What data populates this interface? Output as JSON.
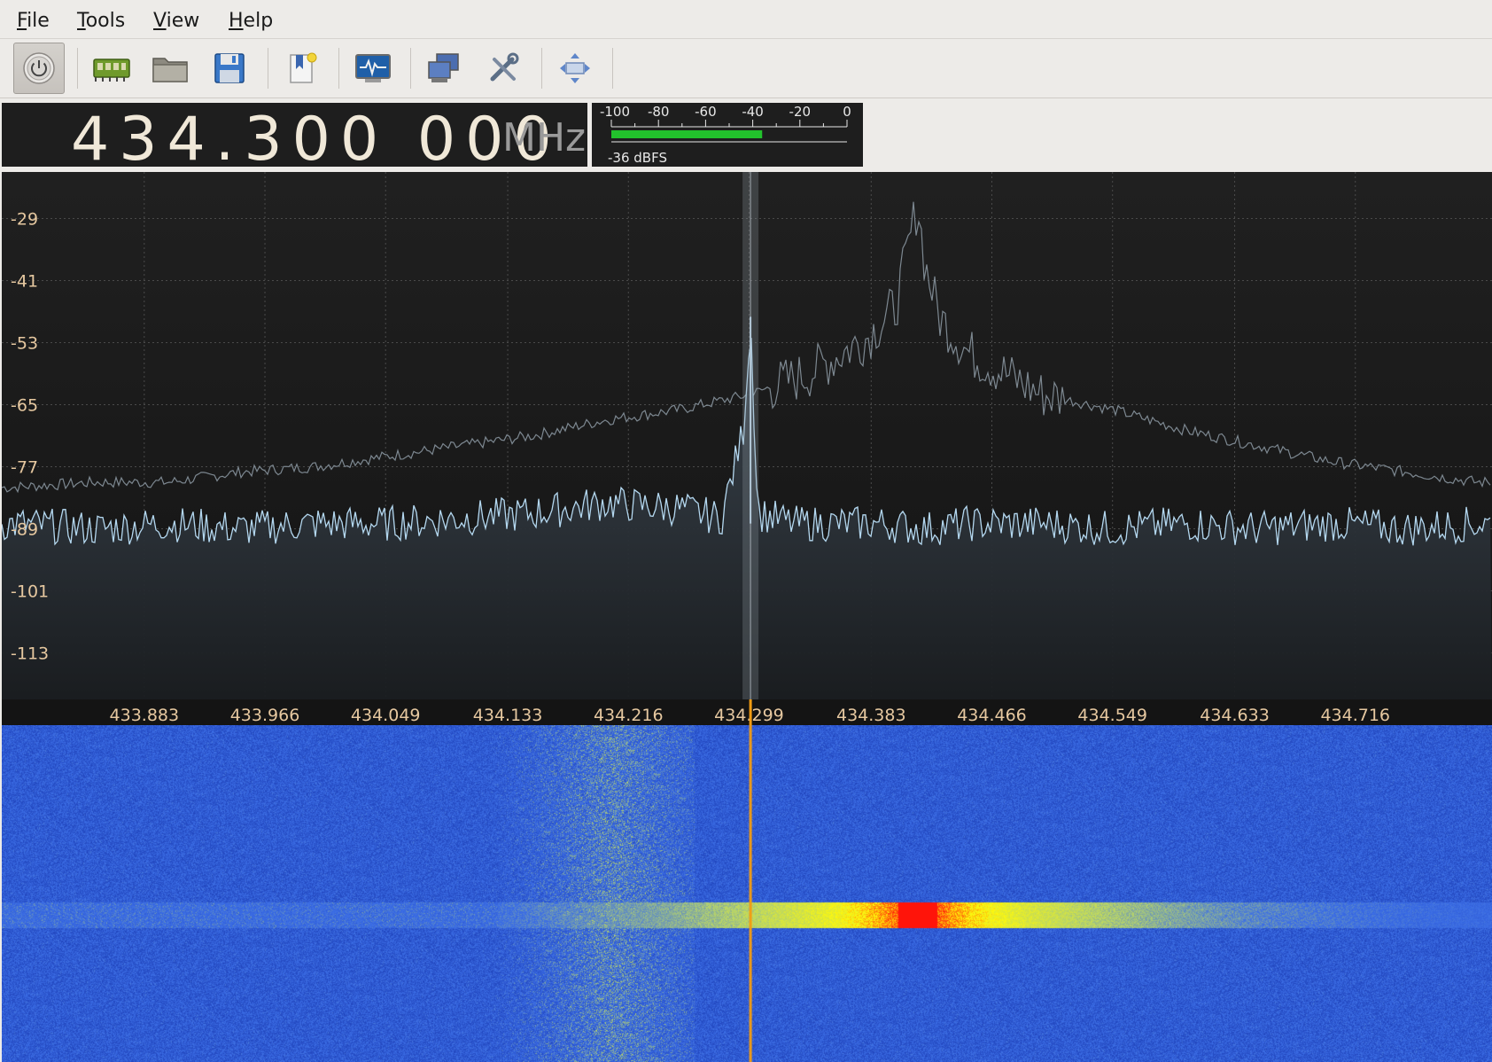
{
  "menu": {
    "items": [
      {
        "label": "File",
        "accel": "F",
        "rest": "ile"
      },
      {
        "label": "Tools",
        "accel": "T",
        "rest": "ools"
      },
      {
        "label": "View",
        "accel": "V",
        "rest": "iew"
      },
      {
        "label": "Help",
        "accel": "H",
        "rest": "elp"
      }
    ]
  },
  "toolbar": {
    "buttons": [
      {
        "name": "power-button",
        "icon": "power-icon",
        "pressed": true
      },
      {
        "name": "device-settings-button",
        "icon": "sdr-device-icon"
      },
      {
        "name": "open-button",
        "icon": "folder-icon"
      },
      {
        "name": "save-button",
        "icon": "floppy-disk-icon"
      },
      {
        "name": "bookmarks-button",
        "icon": "bookmark-icon"
      },
      {
        "name": "io-devices-button",
        "icon": "monitor-waveform-icon"
      },
      {
        "name": "remote-control-button",
        "icon": "network-computers-icon"
      },
      {
        "name": "configure-button",
        "icon": "tools-icon"
      },
      {
        "name": "fit-button",
        "icon": "arrows-expand-icon"
      }
    ]
  },
  "frequency": {
    "digits": "434.300 000",
    "unit": "MHz"
  },
  "meter": {
    "scale": [
      "-100",
      "-80",
      "-60",
      "-40",
      "-20",
      "0"
    ],
    "level_dbfs": -36,
    "readout": "-36 dBFS",
    "bar_color": "#22c22c"
  },
  "spectrum": {
    "y_labels": [
      "-29",
      "-41",
      "-53",
      "-65",
      "-77",
      "-89",
      "-101",
      "-113"
    ],
    "x_labels": [
      "433.883",
      "433.966",
      "434.049",
      "434.133",
      "434.216",
      "434.299",
      "434.383",
      "434.466",
      "434.549",
      "434.633",
      "434.716"
    ],
    "tuned_frequency_label": "434.299",
    "colors": {
      "trace": "#b4d8f0",
      "peak_hold": "#7d8891",
      "label": "#e6c8a0",
      "filter_band": "#8f99a2",
      "marker": "#f39c12"
    }
  },
  "chart_data": {
    "type": "line",
    "title": "",
    "xlabel": "",
    "ylabel": "",
    "xlim": [
      433.785,
      434.81
    ],
    "ylim": [
      -122,
      -20
    ],
    "grid": true,
    "x_ticks": [
      433.883,
      433.966,
      434.049,
      434.133,
      434.216,
      434.299,
      434.383,
      434.466,
      434.549,
      434.633,
      434.716
    ],
    "y_ticks": [
      -29,
      -41,
      -53,
      -65,
      -77,
      -89,
      -101,
      -113
    ],
    "series": [
      {
        "x": [
          433.79,
          433.85,
          433.9,
          433.95,
          434.0,
          434.05,
          434.1,
          434.15,
          434.2,
          434.25,
          434.28,
          434.295,
          434.3,
          434.305,
          434.33,
          434.36,
          434.39,
          434.42,
          434.45,
          434.5,
          434.55,
          434.6,
          434.65,
          434.7,
          434.75,
          434.8
        ],
        "y": [
          -88,
          -89,
          -88,
          -89,
          -88,
          -88,
          -87,
          -86,
          -84,
          -85,
          -87,
          -70,
          -48,
          -86,
          -88,
          -88,
          -88,
          -89,
          -88,
          -88,
          -89,
          -88,
          -89,
          -88,
          -89,
          -88
        ]
      },
      {
        "x": [
          433.79,
          433.85,
          433.9,
          433.95,
          434.0,
          434.05,
          434.1,
          434.15,
          434.2,
          434.25,
          434.3,
          434.34,
          434.38,
          434.4,
          434.415,
          434.42,
          434.43,
          434.45,
          434.5,
          434.55,
          434.6,
          434.65,
          434.7,
          434.75,
          434.8
        ],
        "y": [
          -81,
          -80,
          -80,
          -78,
          -77,
          -75,
          -73,
          -71,
          -68,
          -66,
          -63,
          -59,
          -52,
          -46,
          -26,
          -38,
          -48,
          -55,
          -63,
          -66,
          -70,
          -73,
          -76,
          -78,
          -80
        ]
      }
    ]
  }
}
